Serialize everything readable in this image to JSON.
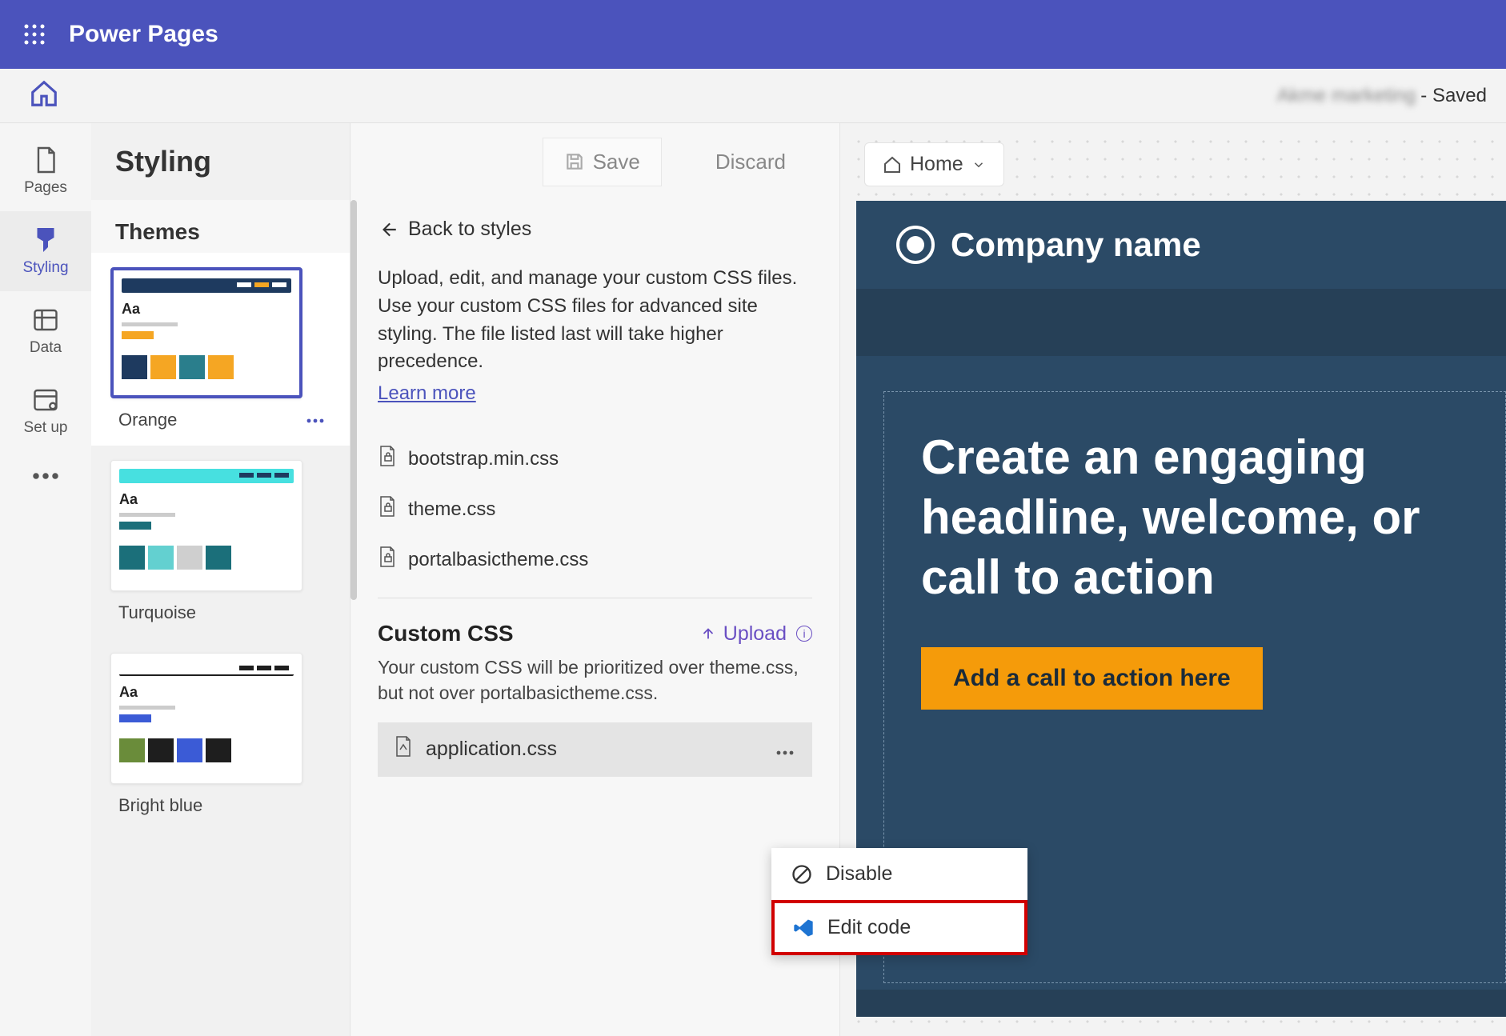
{
  "app": {
    "title": "Power Pages"
  },
  "toolbar": {
    "site_name": "Akme marketing",
    "saved": " - Saved"
  },
  "sidebar": {
    "items": [
      {
        "label": "Pages"
      },
      {
        "label": "Styling"
      },
      {
        "label": "Data"
      },
      {
        "label": "Set up"
      }
    ]
  },
  "styling": {
    "title": "Styling",
    "save_label": "Save",
    "discard_label": "Discard",
    "themes_label": "Themes",
    "themes": [
      {
        "name": "Orange",
        "bar": "#1e3a5f",
        "accent1": "#f5a623",
        "accent2": "#1e3a5f",
        "swatches": [
          "#1e3a5f",
          "#f5a623",
          "#2a7e8c",
          "#f5a623"
        ]
      },
      {
        "name": "Turquoise",
        "bar": "#47e0e0",
        "accent1": "#1e3a5f",
        "accent2": "#1e3a5f",
        "swatches": [
          "#1b6f7a",
          "#63d0d0",
          "#cfcfcf",
          "#1b6f7a"
        ]
      },
      {
        "name": "Bright blue",
        "bar": "#1e1e1e",
        "accent1": "#1e1e1e",
        "accent2": "#1e1e1e",
        "swatches": [
          "#6a8c3a",
          "#1e1e1e",
          "#3b5bd6",
          "#1e1e1e"
        ]
      }
    ]
  },
  "mid": {
    "back_label": "Back to styles",
    "description": "Upload, edit, and manage your custom CSS files. Use your custom CSS files for advanced site styling. The file listed last will take higher precedence.",
    "learn_more": "Learn more",
    "system_files": [
      "bootstrap.min.css",
      "theme.css",
      "portalbasictheme.css"
    ],
    "custom_css_label": "Custom CSS",
    "upload_label": "Upload",
    "custom_note": "Your custom CSS will be prioritized over theme.css, but not over portalbasictheme.css.",
    "custom_file": "application.css"
  },
  "popup": {
    "disable_label": "Disable",
    "edit_code_label": "Edit code"
  },
  "preview": {
    "crumb_label": "Home",
    "company": "Company name",
    "headline": "Create an engaging headline, welcome, or call to action",
    "cta": "Add a call to action here"
  }
}
